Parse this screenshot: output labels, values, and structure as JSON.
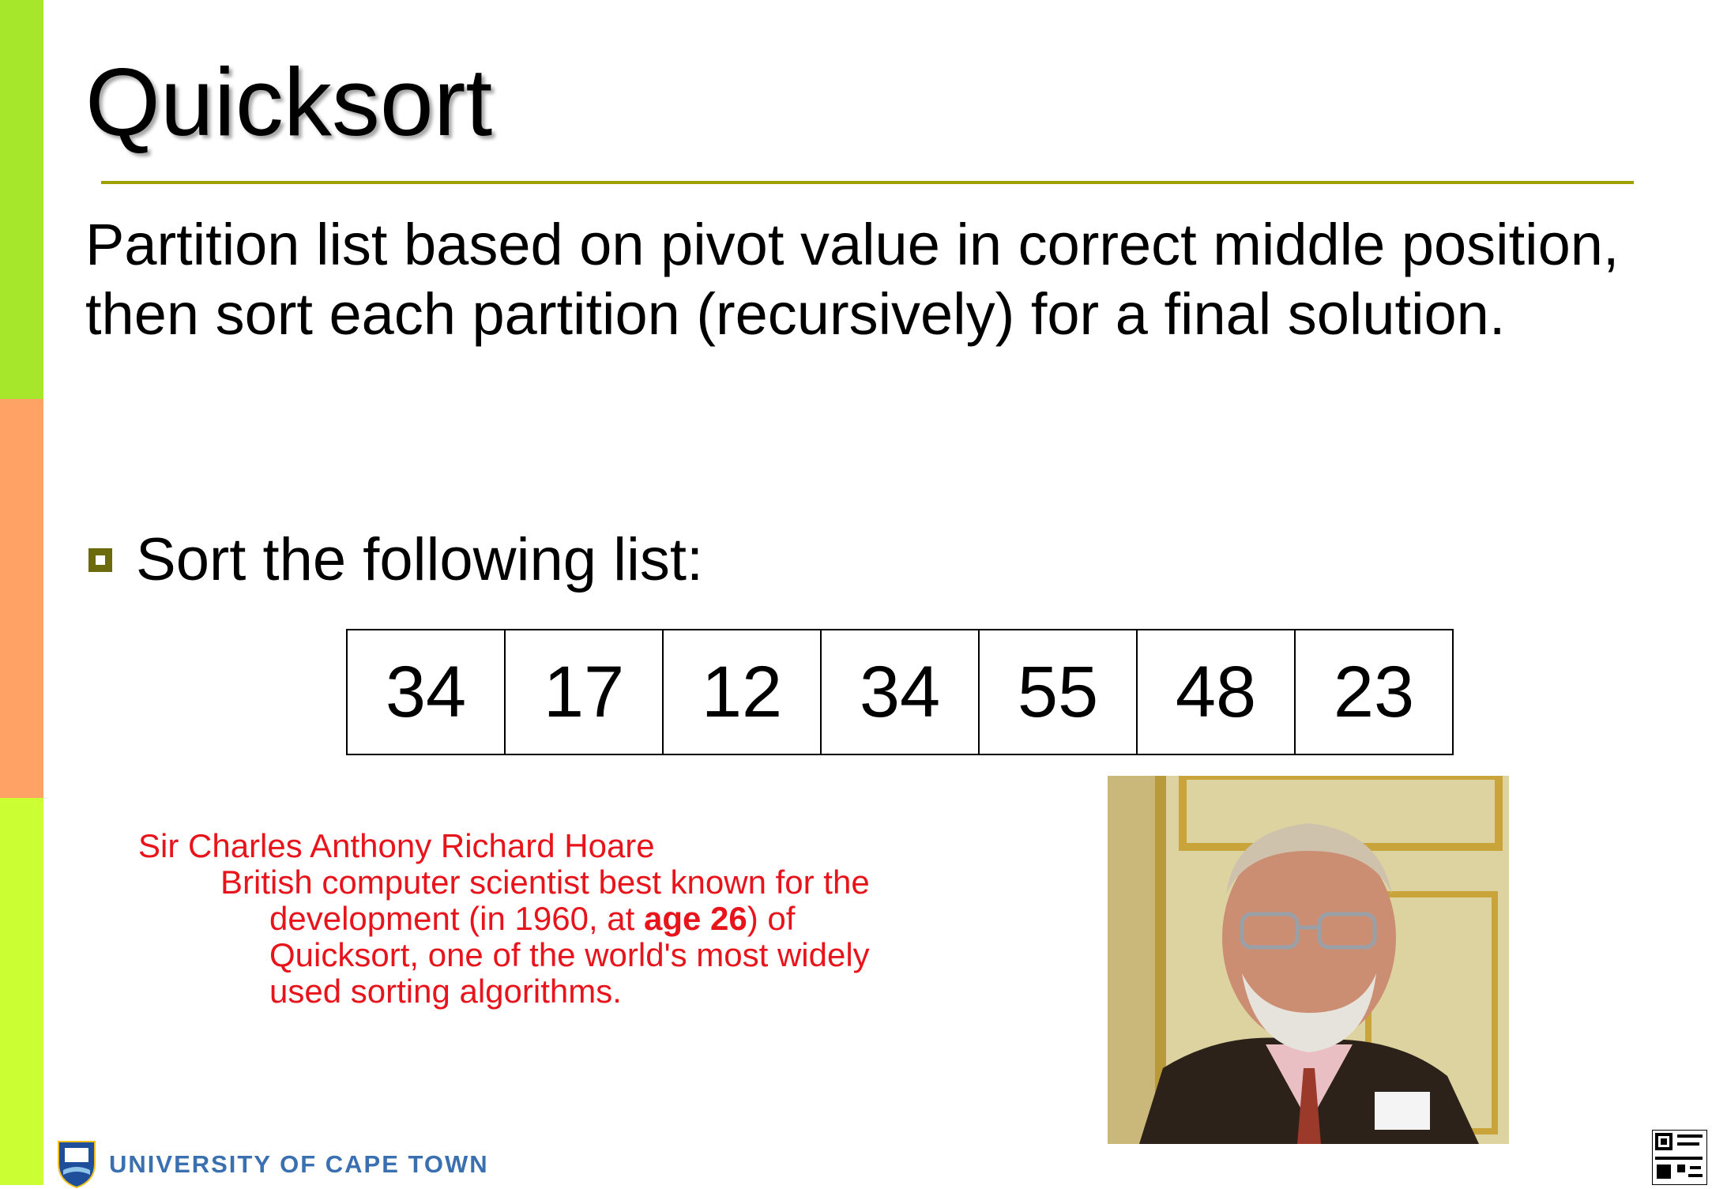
{
  "slide": {
    "title": "Quicksort",
    "intro": "Partition list based on pivot value in correct middle position, then sort each partition (recursively) for a final solution.",
    "bullet": "Sort the following list:",
    "list": [
      "34",
      "17",
      "12",
      "34",
      "55",
      "48",
      "23"
    ]
  },
  "bio": {
    "name": "Sir Charles Anthony Richard Hoare",
    "line2": "British computer scientist best known for the",
    "line3_before": "development (in 1960, at ",
    "line3_bold": "age 26",
    "line3_after": ") of",
    "line4": "Quicksort, one of the world's most widely",
    "line5": "used sorting algorithms."
  },
  "footer": {
    "university": "UNIVERSITY OF CAPE TOWN"
  },
  "colors": {
    "sidebar_top": "#a6e62b",
    "sidebar_mid": "#ffa266",
    "sidebar_bottom": "#ccff33",
    "rule": "#a0a000",
    "bio_text": "#e8141c",
    "logo_text": "#3a6fb0"
  }
}
